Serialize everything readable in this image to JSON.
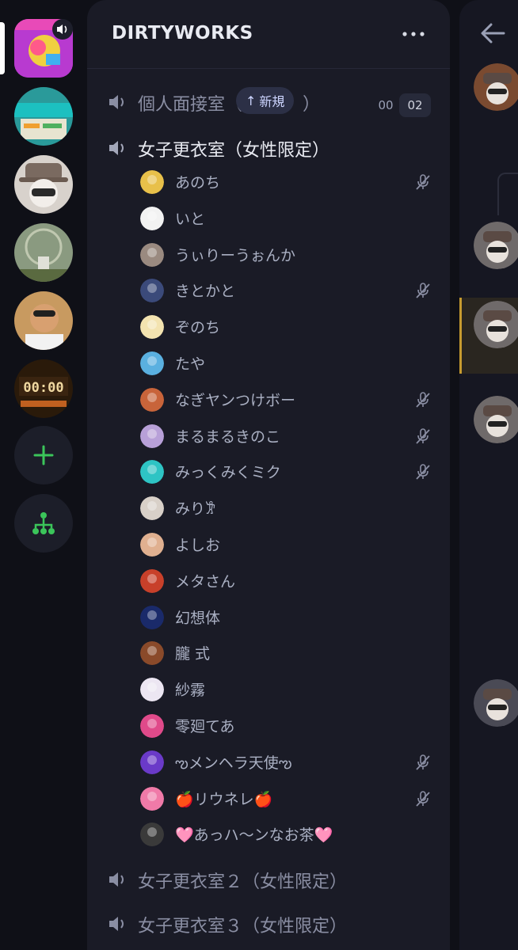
{
  "server": {
    "name": "DIRTYWORKS"
  },
  "servers": [
    {
      "icon": "unga-server-icon",
      "color": "#c23cc8"
    },
    {
      "icon": "staff-server-icon",
      "color": "#2a9a9a"
    },
    {
      "icon": "hat-character-server-icon",
      "color": "#8a7a7a"
    },
    {
      "icon": "ferris-wheel-server-icon",
      "color": "#6b7d5a"
    },
    {
      "icon": "person-photo-server-icon",
      "color": "#b07850"
    },
    {
      "icon": "clock-display-server-icon",
      "color": "#7a4a10"
    }
  ],
  "rail_buttons": [
    {
      "icon": "plus-icon"
    },
    {
      "icon": "server-directory-icon"
    }
  ],
  "channels": [
    {
      "name": "個人面接室（",
      "suffix": "）",
      "new_badge": "新規",
      "counts": [
        "00",
        "02"
      ]
    },
    {
      "name": "女子更衣室（女性限定）"
    },
    {
      "name": "女子更衣室２（女性限定）"
    },
    {
      "name": "女子更衣室３（女性限定）"
    }
  ],
  "members": [
    {
      "name": "あのち",
      "muted": true,
      "color": "#e8c04a"
    },
    {
      "name": "いと",
      "muted": false,
      "color": "#f2f2f2"
    },
    {
      "name": "うぃりーうぉんか",
      "muted": false,
      "color": "#9a8a80"
    },
    {
      "name": "きとかと",
      "muted": true,
      "color": "#3b4a7a"
    },
    {
      "name": "ぞのち",
      "muted": false,
      "color": "#f3e3b0"
    },
    {
      "name": "たや",
      "muted": false,
      "color": "#5ab0e0"
    },
    {
      "name": "なぎヤンつけボー",
      "muted": true,
      "color": "#c8643a"
    },
    {
      "name": "まるまるきのこ",
      "muted": true,
      "color": "#b8a0d8"
    },
    {
      "name": "みっくみくミク",
      "muted": true,
      "color": "#2ec4c4"
    },
    {
      "name": "みり𐦂",
      "muted": false,
      "color": "#d8d0c8"
    },
    {
      "name": "よしお",
      "muted": false,
      "color": "#e0b090"
    },
    {
      "name": "メタさん",
      "muted": false,
      "color": "#c8402a"
    },
    {
      "name": "幻想体",
      "muted": false,
      "color": "#1a2a6a"
    },
    {
      "name": "朧 式",
      "muted": false,
      "color": "#8a4a2a"
    },
    {
      "name": "紗霧",
      "muted": false,
      "color": "#ece6f2"
    },
    {
      "name": "零廻てあ",
      "muted": false,
      "color": "#e04a8a"
    },
    {
      "name": "ఌメンヘラ天使ఌ",
      "muted": true,
      "color": "#6a3ac8"
    },
    {
      "name": "🍎リウネレ🍎",
      "muted": true,
      "color": "#f07aa8"
    },
    {
      "name": "🩷あっハ〜ンなお茶🩷",
      "muted": false,
      "color": "#3a3a3a"
    }
  ],
  "right_avatars": [
    {
      "icon": "hat-character-avatar",
      "color": "#7a4a30"
    },
    {
      "icon": "hat-character-avatar",
      "color": "#6f6a6a"
    },
    {
      "icon": "hat-character-avatar",
      "color": "#6f6a6a"
    },
    {
      "icon": "hat-character-avatar",
      "color": "#6f6a6a"
    },
    {
      "icon": "user-photo-avatar",
      "color": "#4a4a55"
    }
  ],
  "colors": {
    "accent_green": "#3bc55a",
    "panel": "#1a1b26",
    "highlight": "#c69b2f"
  }
}
